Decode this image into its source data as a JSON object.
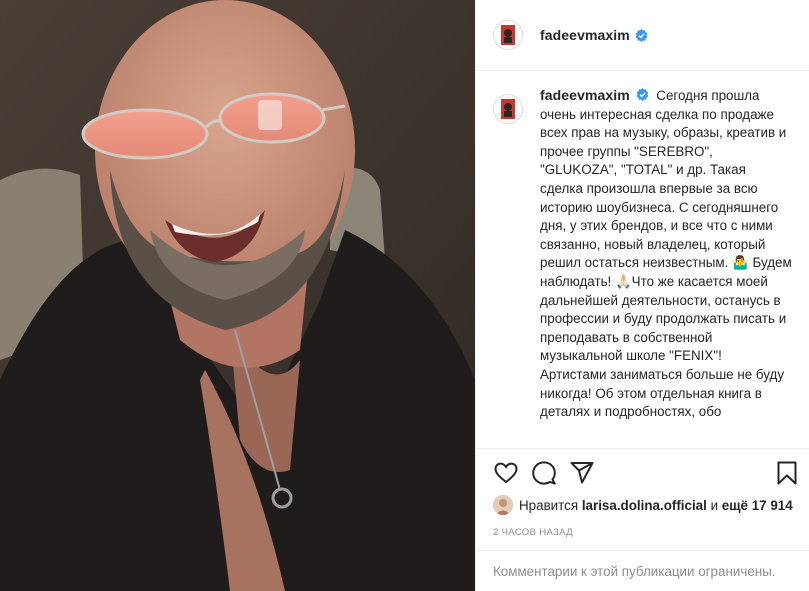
{
  "post": {
    "username": "fadeevmaxim",
    "verified": true,
    "caption": "Сегодня прошла очень интересная сделка по продаже всех прав на музыку, образы, креатив и прочее группы \"SEREBRO\", \"GLUKOZA\", \"TOTAL\" и др. Такая сделка произошла впервые за всю историю шоубизнеса. С сегодняшнего дня, у этих брендов, и все что с ними связанно, новый владелец, который решил остаться неизвестным. 🤷‍♂️ Будем наблюдать! 🙏🏻Что же касается моей дальнейшей деятельности, останусь в профессии и буду продолжать писать и преподавать в собственной музыкальной школе \"FENIX\"! Артистами заниматься больше не буду никогда! Об этом отдельная книга в деталях и подробностях, обо",
    "likes": {
      "prefix": "Нравится",
      "liker": "larisa.dolina.official",
      "connector": "и",
      "more": "ещё 17 914"
    },
    "timestamp": "2 часов назад",
    "comments_note": "Комментарии к этой публикации ограничены."
  },
  "icons": [
    "heart-icon",
    "comment-icon",
    "share-icon",
    "bookmark-icon",
    "verified-icon"
  ],
  "colors": {
    "text": "#262626",
    "muted": "#8e8e8e",
    "verified": "#3897f0",
    "border": "#efefef"
  }
}
